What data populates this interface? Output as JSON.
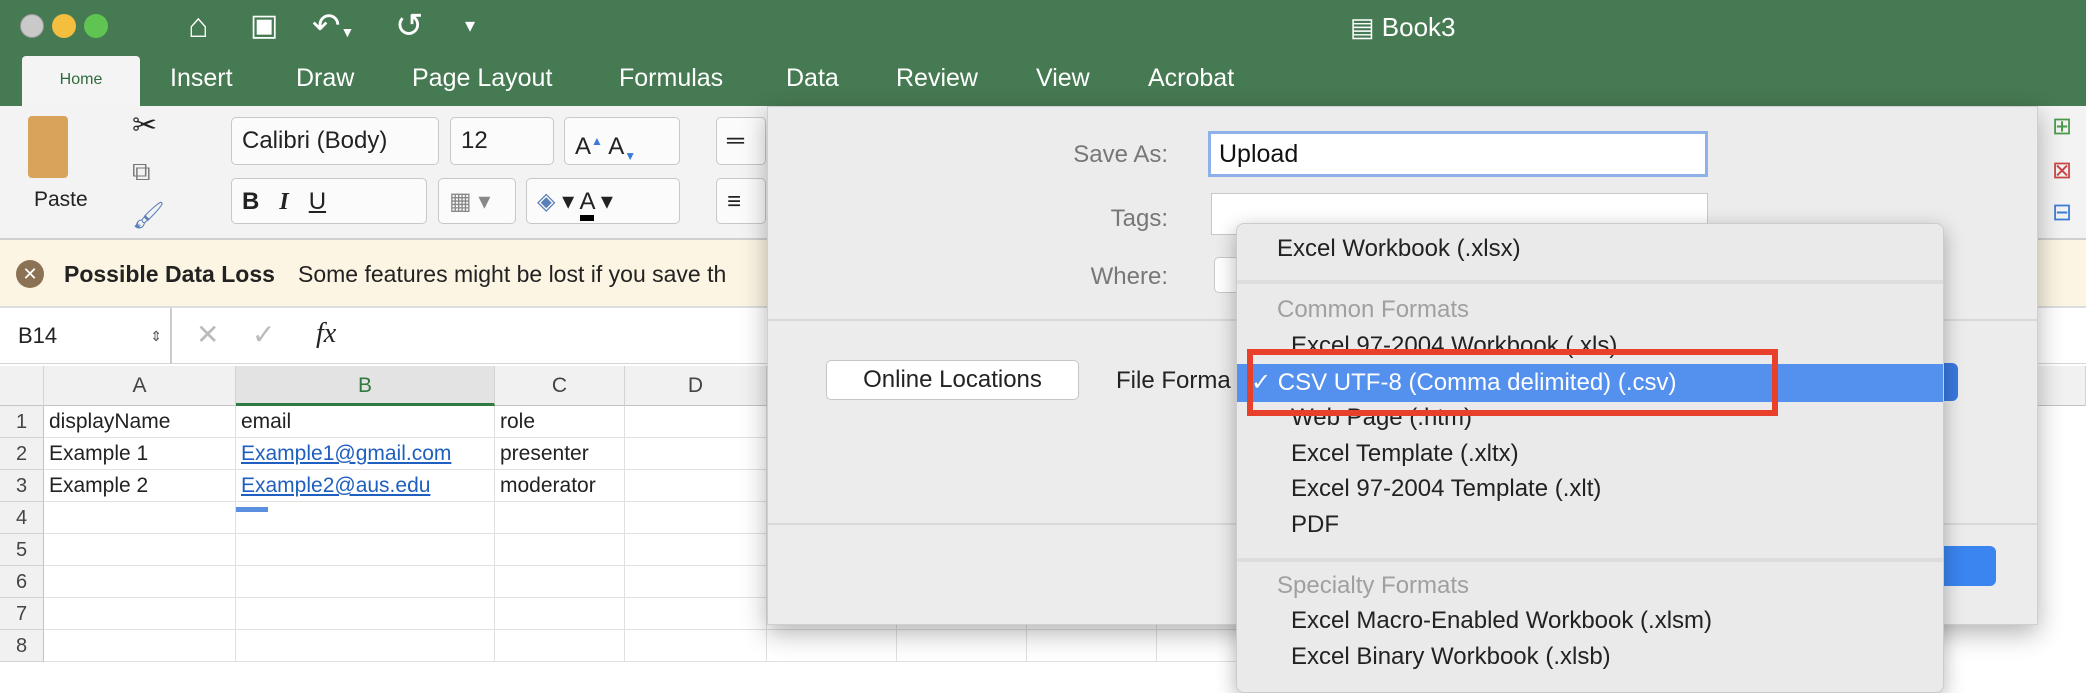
{
  "window": {
    "title": "Book3",
    "quick_access": {
      "home": "home-icon",
      "save": "save-icon",
      "undo": "undo-icon",
      "redo": "redo-icon",
      "customize": "customize-icon"
    }
  },
  "tabs": [
    "Home",
    "Insert",
    "Draw",
    "Page Layout",
    "Formulas",
    "Data",
    "Review",
    "View",
    "Acrobat"
  ],
  "ribbon": {
    "paste": "Paste",
    "font": "Calibri (Body)",
    "size": "12",
    "bold": "B",
    "italic": "I",
    "underline": "U",
    "font_color_letter": "A"
  },
  "warning": {
    "title": "Possible Data Loss",
    "message": "Some features might be lost if you save th"
  },
  "formula_bar": {
    "name_box": "B14",
    "fx": "fx",
    "formula": ""
  },
  "sheet": {
    "columns": [
      "A",
      "B",
      "C",
      "D"
    ],
    "rows": [
      "1",
      "2",
      "3",
      "4",
      "5",
      "6",
      "7",
      "8"
    ],
    "cells": [
      [
        "displayName",
        "email",
        "role"
      ],
      [
        "Example 1",
        "Example1@gmail.com",
        "presenter"
      ],
      [
        "Example 2",
        "Example2@aus.edu",
        "moderator"
      ]
    ]
  },
  "dialog": {
    "save_as_label": "Save As:",
    "save_as_value": "Upload",
    "tags_label": "Tags:",
    "tags_value": "",
    "where_label": "Where:",
    "online_locations": "Online Locations",
    "file_format_label": "File Forma"
  },
  "format_menu": {
    "top": "Excel Workbook (.xlsx)",
    "common_header": "Common Formats",
    "common": [
      "Excel 97-2004 Workbook (.xls)",
      "CSV UTF-8 (Comma delimited) (.csv)",
      "Web Page (.htm)",
      "Excel Template (.xltx)",
      "Excel 97-2004 Template (.xlt)",
      "PDF"
    ],
    "selected": "✓ CSV UTF-8 (Comma delimited) (.csv)",
    "specialty_header": "Specialty Formats",
    "specialty": [
      "Excel Macro-Enabled Workbook (.xlsm)",
      "Excel Binary Workbook (.xlsb)"
    ]
  },
  "colors": {
    "titlebar": "#467a52",
    "highlight": "#5490ee",
    "annotation": "#e8402a"
  }
}
